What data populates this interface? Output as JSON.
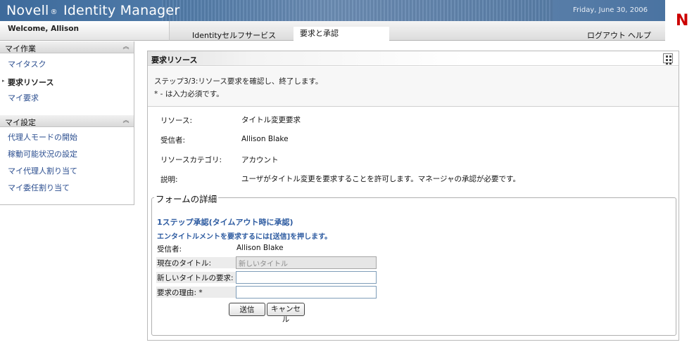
{
  "header": {
    "product_name": "Novell",
    "registered_mark": "®",
    "product_suffix": "Identity Manager",
    "date": "Friday, June 30, 2006",
    "logo_letter": "N",
    "welcome": "Welcome, Allison"
  },
  "tabs": {
    "selfservice": "Identityセルフサービス",
    "requests": "要求と承認",
    "logout": "ログアウト",
    "help": "ヘルプ"
  },
  "sidebar": {
    "section1": {
      "title": "マイ作業",
      "items": [
        {
          "label": "マイタスク"
        },
        {
          "label": "要求リソース",
          "current": true
        },
        {
          "label": "マイ要求"
        }
      ]
    },
    "section2": {
      "title": "マイ設定",
      "items": [
        {
          "label": "代理人モードの開始"
        },
        {
          "label": "稼動可能状況の設定"
        },
        {
          "label": "マイ代理人割り当て"
        },
        {
          "label": "マイ委任割り当て"
        }
      ]
    }
  },
  "panel": {
    "title": "要求リソース",
    "intro_step": "ステップ3/3:リソース要求を確認し、終了します。",
    "intro_required": "* - は入力必須です。",
    "info": {
      "resource_label": "リソース:",
      "resource_value": "タイトル変更要求",
      "recipient_label": "受信者:",
      "recipient_value": "Allison Blake",
      "category_label": "リソースカテゴリ:",
      "category_value": "アカウント",
      "description_label": "説明:",
      "description_value": "ユーザがタイトル変更を要求することを許可します。マネージャの承認が必要です。"
    },
    "form": {
      "legend": "フォームの詳細",
      "workflow_title": "1ステップ承認(タイムアウト時に承認)",
      "workflow_instruction": "エンタイトルメントを要求するには[送信]を押します。",
      "recipient_label": "受信者:",
      "recipient_value": "Allison Blake",
      "current_title_label": "現在のタイトル:",
      "current_title_value": "新しいタイトル",
      "new_title_label": "新しいタイトルの要求:",
      "new_title_value": "",
      "reason_label": "要求の理由: *",
      "reason_value": "",
      "submit_label": "送信",
      "cancel_label": "キャンセル"
    }
  },
  "colors": {
    "header_blue": "#4f7aa8",
    "link_blue": "#2a4d8f",
    "workflow_blue": "#2c5aa0",
    "novell_red": "#cc0000"
  }
}
